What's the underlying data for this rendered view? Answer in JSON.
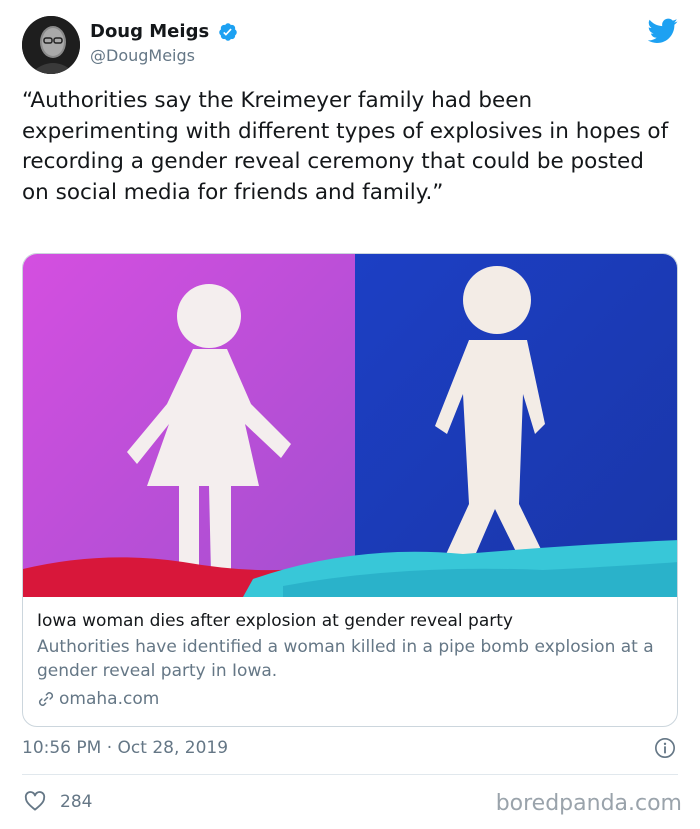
{
  "author": {
    "display_name": "Doug Meigs",
    "handle": "@DougMeigs",
    "verified": true,
    "avatar_icon": "profile-photo"
  },
  "brand_icon": "twitter-bird-icon",
  "tweet": {
    "text": "“Authorities say the Kreimeyer family had been experimenting with different types of explosives in hopes of recording a gender reveal ceremony that could be posted on social media for friends and family.”"
  },
  "card": {
    "image_icon": "gender-figures-image",
    "title": "Iowa woman dies after explosion at gender reveal party",
    "description": "Authorities have identified a woman killed in a pipe bomb explosion at a gender reveal party in Iowa.",
    "domain": "omaha.com"
  },
  "meta": {
    "timestamp": "10:56 PM · Oct 28, 2019"
  },
  "engagement": {
    "likes": "284"
  },
  "watermark": "boredpanda.com",
  "colors": {
    "twitter_blue": "#1da1f2",
    "secondary_text": "#657786",
    "image_left_bg": "#c14fd8",
    "image_right_bg": "#1f3fb8"
  }
}
